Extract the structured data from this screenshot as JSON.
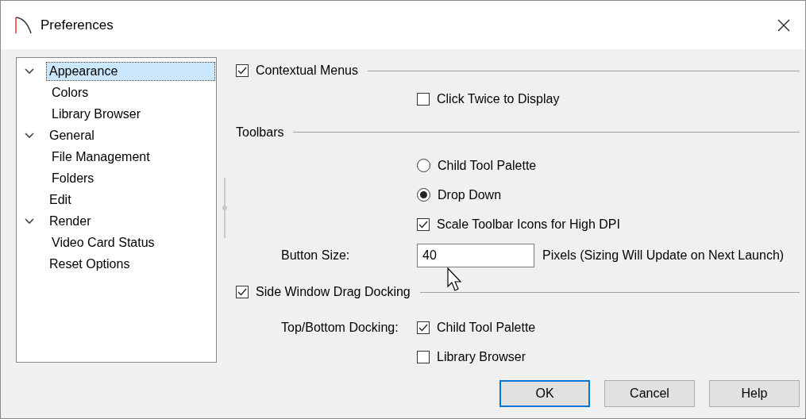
{
  "window": {
    "title": "Preferences"
  },
  "tree": [
    {
      "label": "Appearance",
      "selected": true,
      "expanded": true,
      "children": [
        {
          "label": "Colors",
          "selected": false
        },
        {
          "label": "Library Browser",
          "selected": false
        }
      ]
    },
    {
      "label": "General",
      "selected": false,
      "expanded": true,
      "children": [
        {
          "label": "File Management",
          "selected": false
        },
        {
          "label": "Folders",
          "selected": false
        }
      ]
    },
    {
      "label": "Edit",
      "selected": false
    },
    {
      "label": "Render",
      "selected": false,
      "expanded": true,
      "children": [
        {
          "label": "Video Card Status",
          "selected": false
        }
      ]
    },
    {
      "label": "Reset Options",
      "selected": false
    }
  ],
  "rows": [
    {
      "kind": "group_checkbox",
      "label": "Contextual Menus",
      "checked": true
    },
    {
      "kind": "checkbox",
      "label": "Click Twice to Display",
      "checked": false
    },
    {
      "kind": "group_header",
      "label": "Toolbars"
    },
    {
      "kind": "radio",
      "label": "Child Tool Palette",
      "selected": false
    },
    {
      "kind": "radio",
      "label": "Drop Down",
      "selected": true
    },
    {
      "kind": "checkbox",
      "label": "Scale Toolbar Icons for High DPI",
      "checked": true
    },
    {
      "kind": "field",
      "label": "Button Size:",
      "value": "40",
      "suffix": "Pixels (Sizing Will Update on Next Launch)"
    },
    {
      "kind": "group_checkbox",
      "label": "Side Window Drag Docking",
      "checked": true
    },
    {
      "kind": "labeled_checkbox",
      "label": "Top/Bottom Docking:",
      "option": "Child Tool Palette",
      "checked": true
    },
    {
      "kind": "checkbox",
      "label": "Library Browser",
      "checked": false
    }
  ],
  "buttons": [
    {
      "label": "OK",
      "default": true
    },
    {
      "label": "Cancel",
      "default": false
    },
    {
      "label": "Help",
      "default": false
    }
  ]
}
